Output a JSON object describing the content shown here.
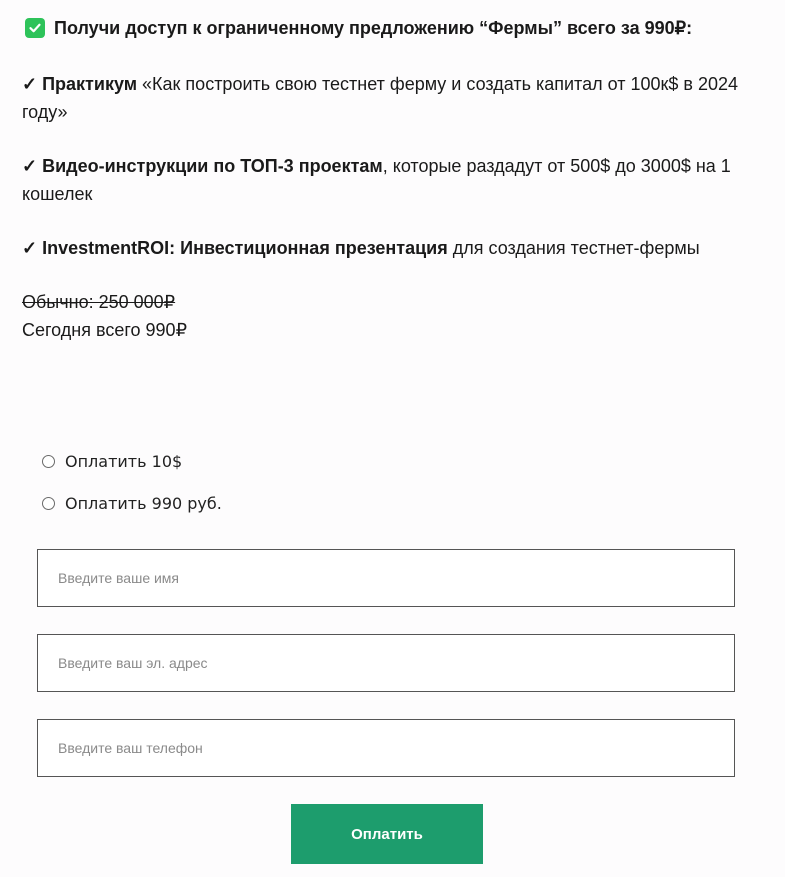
{
  "offer": {
    "headline": "Получи доступ к ограниченному предложению “Фермы” всего за 990₽:",
    "items": [
      {
        "check": "✓",
        "bold": "Практикум",
        "text": " «Как построить свою тестнет ферму и создать капитал от 100к$ в 2024 году»"
      },
      {
        "check": "✓",
        "bold": "Видео-инструкции по ТОП-3 проектам",
        "text": ",  которые раздадут от 500$ до 3000$ на 1 кошелек"
      },
      {
        "check": "✓",
        "bold": "InvestmentROI: Инвестиционная презентация",
        "text": " для создания тестнет-фермы"
      }
    ],
    "old_price": "Обычно: 250 000₽",
    "today_price": "Сегодня всего 990₽"
  },
  "payment_options": [
    {
      "label": "Оплатить 10$"
    },
    {
      "label": "Оплатить 990 руб."
    }
  ],
  "form": {
    "name_placeholder": "Введите ваше имя",
    "email_placeholder": "Введите ваш эл. адрес",
    "phone_placeholder": "Введите ваш телефон",
    "submit_label": "Оплатить"
  },
  "colors": {
    "accent_green": "#1d9d6d",
    "checkbox_green": "#2ec35a"
  },
  "icons": {
    "headline_icon": "checkbox-checked-icon"
  }
}
